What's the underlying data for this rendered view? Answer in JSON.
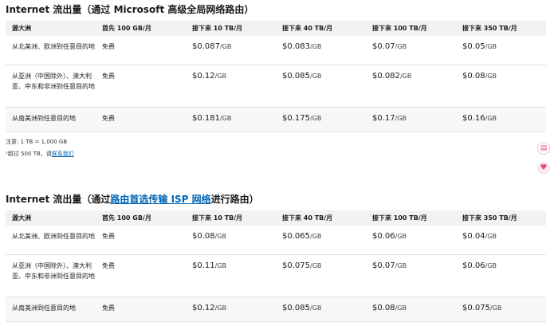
{
  "sections": [
    {
      "title": "Internet 流出量（通过 Microsoft 高级全局网络路由）",
      "headers": [
        "源大洲",
        "首先 100 GB/月",
        "接下来 10 TB/月",
        "接下来 40 TB/月",
        "接下来 100 TB/月",
        "接下来 350 TB/月"
      ],
      "rows": [
        {
          "source": "从北美洲、欧洲到任意目的地",
          "first": "免费",
          "prices": [
            "$0.087",
            "$0.083",
            "$0.07",
            "$0.05"
          ]
        },
        {
          "source": "从亚洲（中国除外）、澳大利亚、中东和非洲到任意目的地",
          "first": "免费",
          "prices": [
            "$0.12",
            "$0.085",
            "$0.082",
            "$0.08"
          ]
        },
        {
          "source": "从南美洲到任意目的地",
          "first": "免费",
          "prices": [
            "$0.181",
            "$0.175",
            "$0.17",
            "$0.16"
          ]
        }
      ]
    },
    {
      "title_prefix": "Internet 流出量（通过",
      "title_link": "路由首选传输 ISP 网络",
      "title_suffix": "进行路由）",
      "headers": [
        "源大洲",
        "首先 100 GB/月",
        "接下来 10 TB/月",
        "接下来 40 TB/月",
        "接下来 100 TB/月",
        "接下来 350 TB/月"
      ],
      "rows": [
        {
          "source": "从北美洲、欧洲到任意目的地",
          "first": "免费",
          "prices": [
            "$0.08",
            "$0.065",
            "$0.06",
            "$0.04"
          ]
        },
        {
          "source": "从亚洲（中国除外）、澳大利亚、中东和非洲到任意目的地",
          "first": "免费",
          "prices": [
            "$0.11",
            "$0.075",
            "$0.07",
            "$0.06"
          ]
        },
        {
          "source": "从南美洲到任意目的地",
          "first": "免费",
          "prices": [
            "$0.12",
            "$0.085",
            "$0.08",
            "$0.075"
          ]
        }
      ]
    }
  ],
  "unit": "/GB",
  "notes": {
    "note1": "注意: 1 TB = 1,000 GB",
    "note2_prefix": "¹超过 500 TB，请",
    "note2_link": "联系我们"
  },
  "side_icons": [
    "document-icon",
    "heart-icon"
  ]
}
